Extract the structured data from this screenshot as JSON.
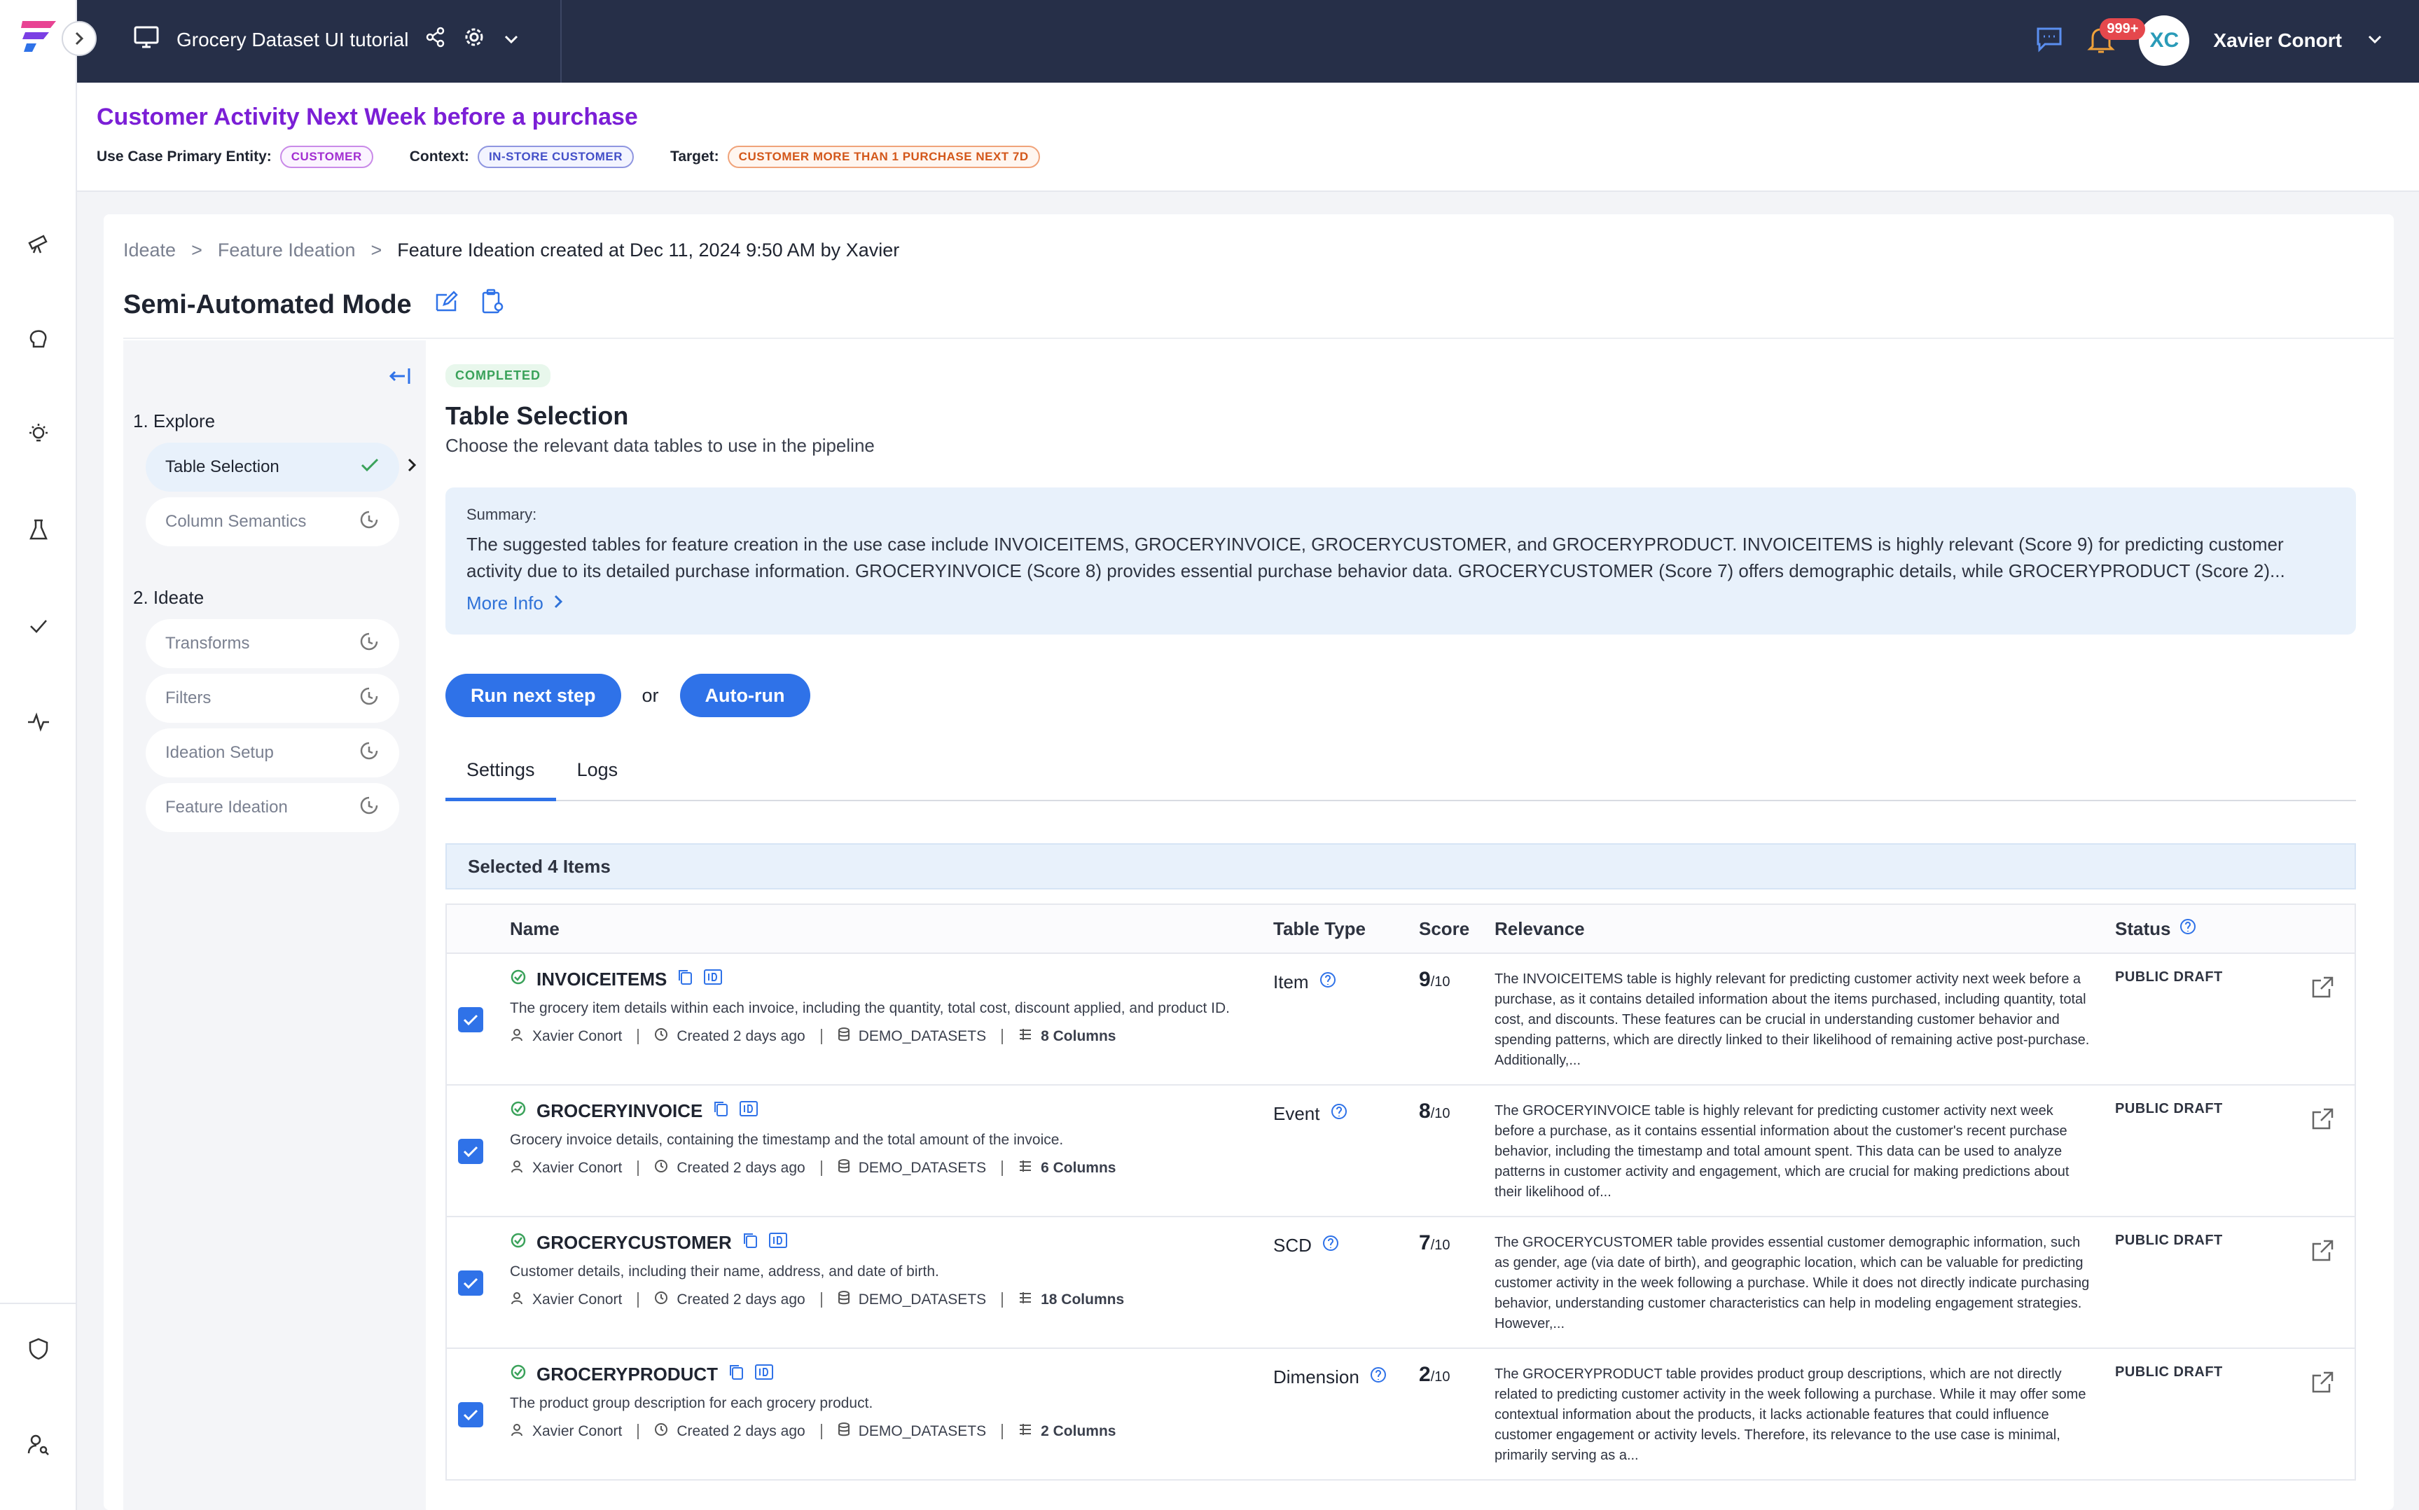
{
  "topbar": {
    "project_title": "Grocery Dataset UI tutorial",
    "notification_count": "999+",
    "avatar_initials": "XC",
    "user_name": "Xavier Conort"
  },
  "use_case": {
    "title": "Customer Activity Next Week before a purchase",
    "entity_label": "Use Case Primary Entity:",
    "entity_value": "CUSTOMER",
    "context_label": "Context:",
    "context_value": "IN-STORE CUSTOMER",
    "target_label": "Target:",
    "target_value": "CUSTOMER MORE THAN 1 PURCHASE NEXT 7D"
  },
  "breadcrumb": {
    "items": [
      "Ideate",
      "Feature Ideation",
      "Feature Ideation created at Dec 11, 2024 9:50 AM by Xavier"
    ],
    "separator": ">"
  },
  "mode_title": "Semi-Automated Mode",
  "steps": {
    "explore_label": "1. Explore",
    "ideate_label": "2. Ideate",
    "explore_items": [
      "Table Selection",
      "Column Semantics"
    ],
    "ideate_items": [
      "Transforms",
      "Filters",
      "Ideation Setup",
      "Feature Ideation"
    ]
  },
  "content": {
    "status": "COMPLETED",
    "title": "Table Selection",
    "subtitle": "Choose the relevant data tables to use in the pipeline",
    "summary_label": "Summary:",
    "summary_text": "The suggested tables for feature creation in the use case include INVOICEITEMS, GROCERYINVOICE, GROCERYCUSTOMER, and GROCERYPRODUCT. INVOICEITEMS is highly relevant (Score 9) for predicting customer activity due to its detailed purchase information. GROCERYINVOICE (Score 8) provides essential purchase behavior data. GROCERYCUSTOMER (Score 7) offers demographic details, while GROCERYPRODUCT (Score 2)...",
    "more_info": "More Info",
    "run_next": "Run next step",
    "or": "or",
    "auto_run": "Auto-run",
    "tabs": [
      "Settings",
      "Logs"
    ],
    "selected": "Selected 4 Items"
  },
  "table": {
    "headers": {
      "name": "Name",
      "type": "Table Type",
      "score": "Score",
      "relevance": "Relevance",
      "status": "Status"
    },
    "score_suffix": "/10",
    "rows": [
      {
        "name": "INVOICEITEMS",
        "desc": "The grocery item details within each invoice, including the quantity, total cost, discount applied, and product ID.",
        "owner": "Xavier Conort",
        "created": "Created 2 days ago",
        "source": "DEMO_DATASETS",
        "columns": "8 Columns",
        "type": "Item",
        "score": "9",
        "relevance": "The INVOICEITEMS table is highly relevant for predicting customer activity next week before a purchase, as it contains detailed information about the items purchased, including quantity, total cost, and discounts. These features can be crucial in understanding customer behavior and spending patterns, which are directly linked to their likelihood of remaining active post-purchase. Additionally,...",
        "status": "PUBLIC DRAFT"
      },
      {
        "name": "GROCERYINVOICE",
        "desc": "Grocery invoice details, containing the timestamp and the total amount of the invoice.",
        "owner": "Xavier Conort",
        "created": "Created 2 days ago",
        "source": "DEMO_DATASETS",
        "columns": "6 Columns",
        "type": "Event",
        "score": "8",
        "relevance": "The GROCERYINVOICE table is highly relevant for predicting customer activity next week before a purchase, as it contains essential information about the customer's recent purchase behavior, including the timestamp and total amount spent. This data can be used to analyze patterns in customer activity and engagement, which are crucial for making predictions about their likelihood of...",
        "status": "PUBLIC DRAFT"
      },
      {
        "name": "GROCERYCUSTOMER",
        "desc": "Customer details, including their name, address, and date of birth.",
        "owner": "Xavier Conort",
        "created": "Created 2 days ago",
        "source": "DEMO_DATASETS",
        "columns": "18 Columns",
        "type": "SCD",
        "score": "7",
        "relevance": "The GROCERYCUSTOMER table provides essential customer demographic information, such as gender, age (via date of birth), and geographic location, which can be valuable for predicting customer activity in the week following a purchase. While it does not directly indicate purchasing behavior, understanding customer characteristics can help in modeling engagement strategies. However,...",
        "status": "PUBLIC DRAFT"
      },
      {
        "name": "GROCERYPRODUCT",
        "desc": "The product group description for each grocery product.",
        "owner": "Xavier Conort",
        "created": "Created 2 days ago",
        "source": "DEMO_DATASETS",
        "columns": "2 Columns",
        "type": "Dimension",
        "score": "2",
        "relevance": "The GROCERYPRODUCT table provides product group descriptions, which are not directly related to predicting customer activity in the week following a purchase. While it may offer some contextual information about the products, it lacks actionable features that could influence customer engagement or activity levels. Therefore, its relevance to the use case is minimal, primarily serving as a...",
        "status": "PUBLIC DRAFT"
      }
    ]
  },
  "colors": {
    "accent": "#2f72e8",
    "topbar": "#262f48",
    "title_purple": "#7b1fd6",
    "success": "#3aa25a"
  }
}
